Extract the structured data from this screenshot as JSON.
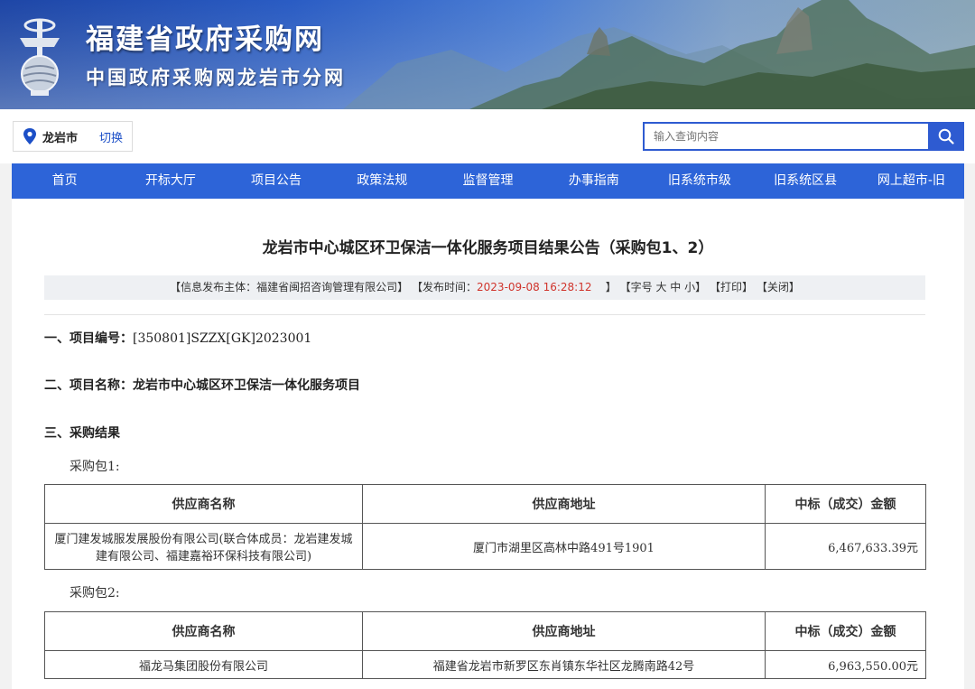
{
  "banner": {
    "title": "福建省政府采购网",
    "subtitle": "中国政府采购网龙岩市分网"
  },
  "location": {
    "city": "龙岩市",
    "switch_label": "切换"
  },
  "search": {
    "placeholder": "输入查询内容"
  },
  "nav": {
    "items": [
      "首页",
      "开标大厅",
      "项目公告",
      "政策法规",
      "监督管理",
      "办事指南",
      "旧系统市级",
      "旧系统区县",
      "网上超市-旧"
    ]
  },
  "article": {
    "title": "龙岩市中心城区环卫保洁一体化服务项目结果公告（采购包1、2）",
    "info": {
      "publisher_label": "【信息发布主体：",
      "publisher": "福建省闽招咨询管理有限公司",
      "publisher_end": "】",
      "time_label": "【发布时间：",
      "time": "2023-09-08 16:28:12",
      "time_end": "】",
      "font_label": "【字号",
      "font_large": "大",
      "font_medium": "中",
      "font_small": "小",
      "font_end": "】",
      "print": "【打印】",
      "close": "【关闭】"
    },
    "section1_label": "一、项目编号：",
    "project_number": "[350801]SZZX[GK]2023001",
    "section2_label": "二、项目名称：",
    "project_name": "龙岩市中心城区环卫保洁一体化服务项目",
    "section3_label": "三、采购结果",
    "table_headers": [
      "供应商名称",
      "供应商地址",
      "中标（成交）金额"
    ],
    "packages": [
      {
        "label": "采购包1:",
        "rows": [
          {
            "name": "厦门建发城服发展股份有限公司(联合体成员：龙岩建发城建有限公司、福建嘉裕环保科技有限公司)",
            "address": "厦门市湖里区高林中路491号1901",
            "amount": "6,467,633.39元"
          }
        ]
      },
      {
        "label": "采购包2:",
        "rows": [
          {
            "name": "福龙马集团股份有限公司",
            "address": "福建省龙岩市新罗区东肖镇东华社区龙腾南路42号",
            "amount": "6,963,550.00元"
          }
        ]
      }
    ]
  },
  "colors": {
    "nav_bg": "#2d64d8",
    "search_border": "#2e5bd1",
    "date_red": "#d0342c",
    "link_blue": "#1c4fc7"
  }
}
